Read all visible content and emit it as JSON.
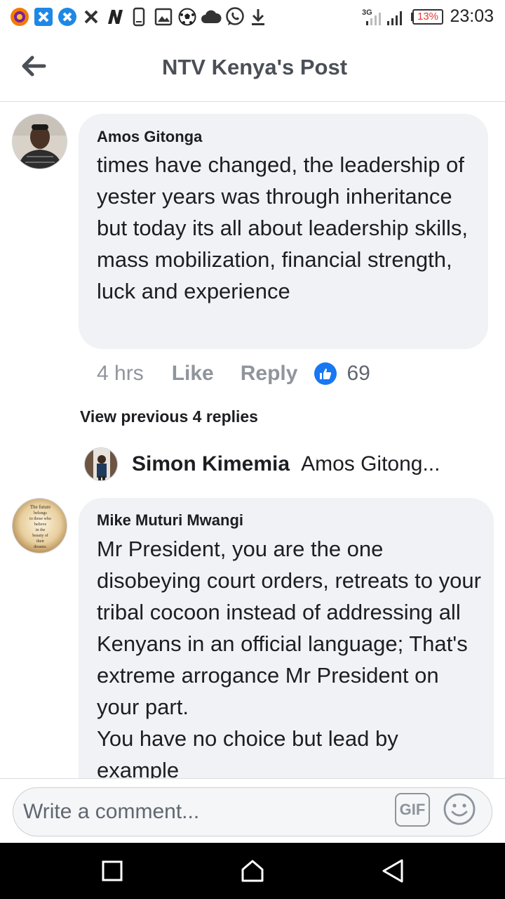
{
  "status_bar": {
    "time": "23:03",
    "battery": "13%",
    "network": "3G",
    "icons": [
      "browser-icon",
      "x-app-icon",
      "x-app-icon",
      "x-icon",
      "n-app-icon",
      "phone-icon",
      "image-icon",
      "soccer-ball-icon",
      "cloud-icon",
      "whatsapp-icon",
      "download-icon",
      "signal-icon",
      "signal-icon",
      "battery-icon"
    ]
  },
  "header": {
    "title": "NTV Kenya's Post",
    "back_icon": "arrow-left-icon"
  },
  "comments": [
    {
      "author": "Amos Gitonga",
      "text": "times have changed, the leadership of yester years was through inheritance but today its all about leadership skills, mass mobilization, financial strength, luck and experience",
      "time": "4 hrs",
      "like_label": "Like",
      "reply_label": "Reply",
      "reactions": "69"
    },
    {
      "author": "Mike Muturi Mwangi",
      "text": "Mr President, you are the one disobeying court orders, retreats to your tribal cocoon instead of addressing all Kenyans in an official language; That's extreme arrogance Mr President on your part.\nYou have no choice but lead by example",
      "avatar_text": "The future belongs to those who believe in the beauty of their dreams."
    }
  ],
  "replies": {
    "view_previous": "View previous 4 replies",
    "latest_author": "Simon Kimemia",
    "latest_text": "Amos Gitong..."
  },
  "composer": {
    "placeholder": "Write a comment...",
    "gif_label": "GIF",
    "emoji_icon": "smiley-icon"
  },
  "colors": {
    "like_blue": "#1877f2",
    "bubble_bg": "#f0f2f5",
    "meta_gray": "#90949c",
    "battery_red": "#e53935"
  }
}
